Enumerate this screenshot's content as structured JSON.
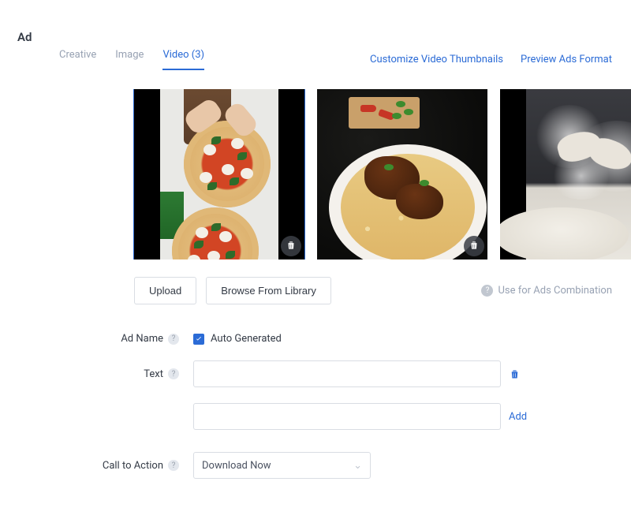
{
  "page_title": "Ad",
  "tabs": {
    "creative": "Creative",
    "image": "Image",
    "video": "Video (3)",
    "active": "video"
  },
  "links": {
    "customize_thumbnails": "Customize Video Thumbnails",
    "preview_ads": "Preview Ads Format"
  },
  "thumbnails": [
    {
      "id": "pizza"
    },
    {
      "id": "biryani"
    },
    {
      "id": "flour"
    }
  ],
  "buttons": {
    "upload": "Upload",
    "browse_library": "Browse From Library"
  },
  "combination_label": "Use for Ads Combination",
  "form": {
    "ad_name": {
      "label": "Ad Name",
      "auto_generated_label": "Auto Generated",
      "auto_generated_checked": true
    },
    "text": {
      "label": "Text",
      "value1": "",
      "value2": "",
      "add_label": "Add"
    },
    "cta": {
      "label": "Call to Action",
      "selected": "Download Now"
    }
  }
}
